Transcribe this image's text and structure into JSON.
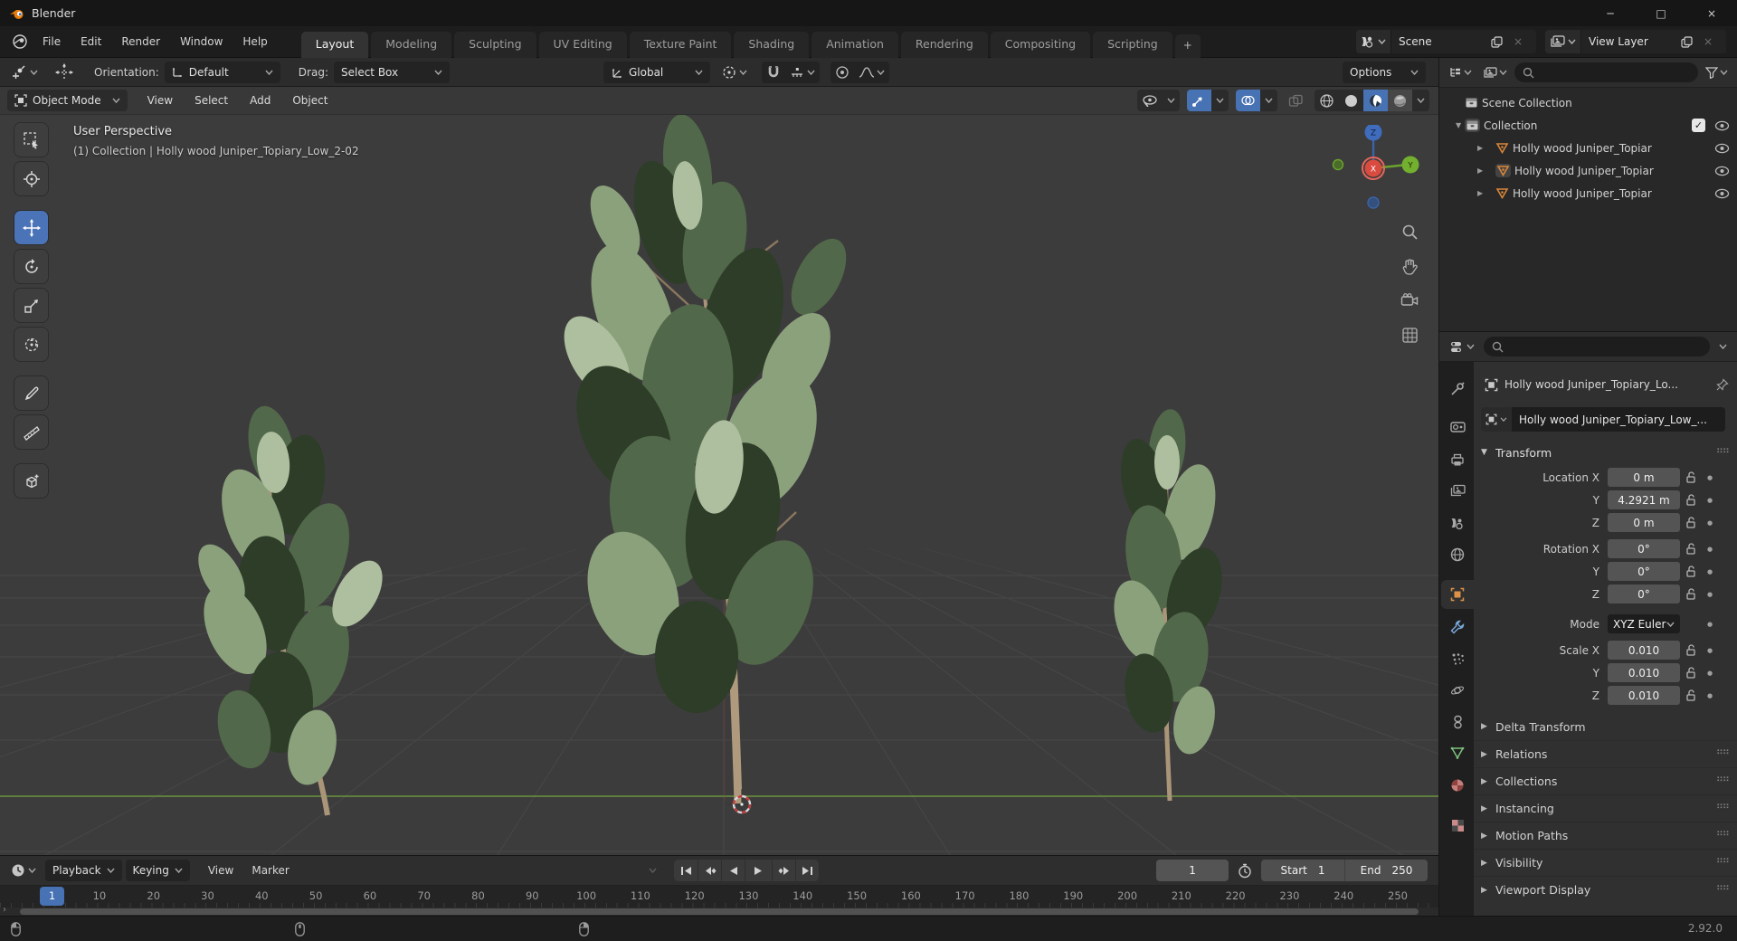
{
  "window": {
    "title": "Blender"
  },
  "glyphs": {
    "tri_down": "▼",
    "tri_right": "▶",
    "close": "×",
    "grip": "⠛⠛",
    "check": "✓",
    "minimize": "─",
    "maximize": "□",
    "dot": "●",
    "expand": "›"
  },
  "topbar": {
    "menus": [
      {
        "label": "File"
      },
      {
        "label": "Edit"
      },
      {
        "label": "Render"
      },
      {
        "label": "Window"
      },
      {
        "label": "Help"
      }
    ],
    "tabs": [
      {
        "label": "Layout"
      },
      {
        "label": "Modeling"
      },
      {
        "label": "Sculpting"
      },
      {
        "label": "UV Editing"
      },
      {
        "label": "Texture Paint"
      },
      {
        "label": "Shading"
      },
      {
        "label": "Animation"
      },
      {
        "label": "Rendering"
      },
      {
        "label": "Compositing"
      },
      {
        "label": "Scripting"
      }
    ],
    "add_tab": "+",
    "scene": {
      "value": "Scene"
    },
    "view_layer": {
      "value": "View Layer"
    }
  },
  "tool_settings": {
    "orientation_label": "Orientation:",
    "orientation_value": "Default",
    "drag_label": "Drag:",
    "drag_value": "Select Box",
    "transform_orientation": "Global",
    "options_label": "Options"
  },
  "viewport": {
    "mode": "Object Mode",
    "menus": [
      {
        "label": "View"
      },
      {
        "label": "Select"
      },
      {
        "label": "Add"
      },
      {
        "label": "Object"
      }
    ],
    "overlay": {
      "line1": "User Perspective",
      "line2": "(1) Collection | Holly wood Juniper_Topiary_Low_2-02"
    },
    "gizmo": {
      "x": "X",
      "y": "Y",
      "z": "Z"
    }
  },
  "outliner": {
    "root": "Scene Collection",
    "collection": "Collection",
    "objects": [
      {
        "label": "Holly wood Juniper_Topiar"
      },
      {
        "label": "Holly wood Juniper_Topiar"
      },
      {
        "label": "Holly wood Juniper_Topiar"
      }
    ]
  },
  "properties": {
    "breadcrumb": "Holly wood Juniper_Topiary_Lo...",
    "object_name": "Holly wood Juniper_Topiary_Low_...",
    "transform": {
      "title": "Transform",
      "rows": [
        {
          "label": "Location X",
          "value": "0 m"
        },
        {
          "label": "Y",
          "value": "4.2921 m"
        },
        {
          "label": "Z",
          "value": "0 m"
        },
        {
          "label": "Rotation X",
          "value": "0°"
        },
        {
          "label": "Y",
          "value": "0°"
        },
        {
          "label": "Z",
          "value": "0°"
        }
      ],
      "mode_label": "Mode",
      "mode_value": "XYZ Euler",
      "scale_rows": [
        {
          "label": "Scale X",
          "value": "0.010"
        },
        {
          "label": "Y",
          "value": "0.010"
        },
        {
          "label": "Z",
          "value": "0.010"
        }
      ]
    },
    "sections": [
      {
        "label": "Delta Transform"
      },
      {
        "label": "Relations"
      },
      {
        "label": "Collections"
      },
      {
        "label": "Instancing"
      },
      {
        "label": "Motion Paths"
      },
      {
        "label": "Visibility"
      },
      {
        "label": "Viewport Display"
      }
    ]
  },
  "timeline": {
    "menus": [
      {
        "label": "Playback"
      },
      {
        "label": "Keying"
      },
      {
        "label": "View"
      },
      {
        "label": "Marker"
      }
    ],
    "current_frame": "1",
    "frame_field": "1",
    "start_label": "Start",
    "start_value": "1",
    "end_label": "End",
    "end_value": "250",
    "ruler": [
      "10",
      "20",
      "30",
      "40",
      "50",
      "60",
      "70",
      "80",
      "90",
      "100",
      "110",
      "120",
      "130",
      "140",
      "150",
      "160",
      "170",
      "180",
      "190",
      "200",
      "210",
      "220",
      "230",
      "240",
      "250"
    ]
  },
  "status_bar": {
    "version": "2.92.0"
  },
  "colors": {
    "accent_blue": "#4772b3",
    "axis_x_red": "#d94a3f",
    "axis_y_green": "#6ba32e",
    "axis_z_blue": "#3b63a8",
    "object_orange": "#dd9147",
    "viewport_gray": "#3c3c3c"
  }
}
